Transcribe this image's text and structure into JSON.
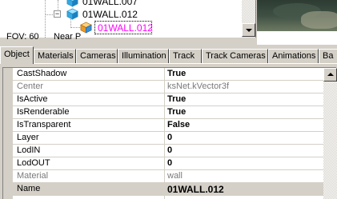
{
  "tree": {
    "items": [
      {
        "label": "01WALL.007"
      },
      {
        "label": "01WALL.012"
      },
      {
        "label": "01WALL.012"
      }
    ],
    "expand_glyph": "−",
    "selected_color": "#ff00ff"
  },
  "viewport": {
    "fov_label": "FOV: 60",
    "nearp_label": "Near P"
  },
  "tabs": [
    {
      "label": "Object"
    },
    {
      "label": "Materials"
    },
    {
      "label": "Cameras"
    },
    {
      "label": "Illumination"
    },
    {
      "label": "Track"
    },
    {
      "label": "Track Cameras"
    },
    {
      "label": "Animations"
    },
    {
      "label": "Ba"
    }
  ],
  "properties": [
    {
      "name": "CastShadow",
      "value": "True"
    },
    {
      "name": "Center",
      "value": "ksNet.kVector3f"
    },
    {
      "name": "IsActive",
      "value": "True"
    },
    {
      "name": "IsRenderable",
      "value": "True"
    },
    {
      "name": "IsTransparent",
      "value": "False"
    },
    {
      "name": "Layer",
      "value": "0"
    },
    {
      "name": "LodIN",
      "value": "0"
    },
    {
      "name": "LodOUT",
      "value": "0"
    },
    {
      "name": "Material",
      "value": "wall"
    },
    {
      "name": "Name",
      "value": "01WALL.012"
    }
  ]
}
